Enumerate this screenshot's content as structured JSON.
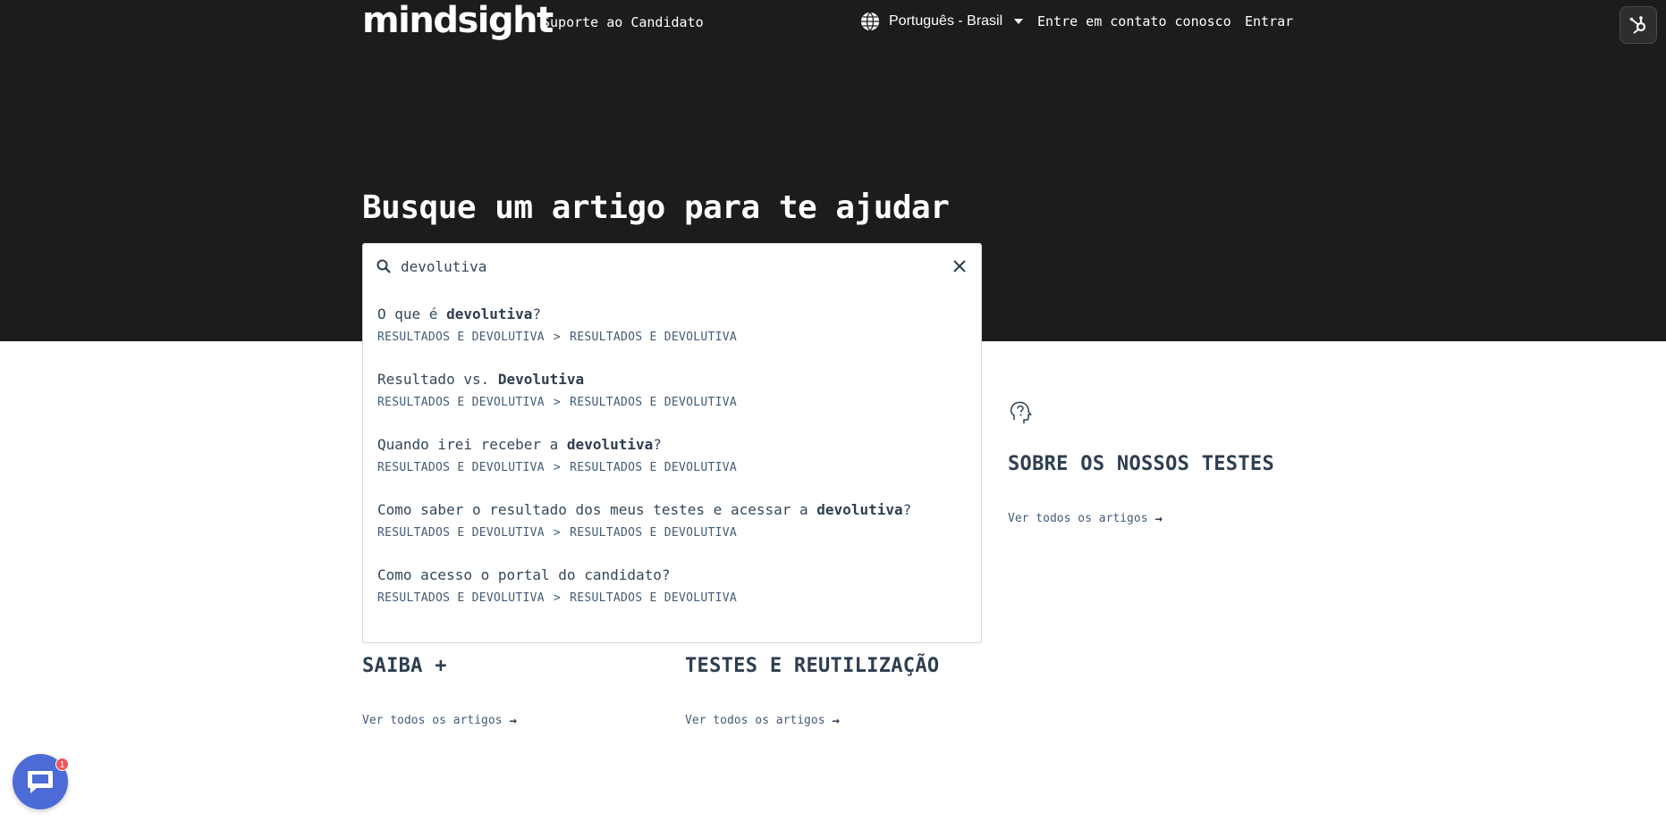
{
  "header": {
    "logo": "mindsight",
    "portal_name": "Suporte ao Candidato",
    "language": "Português - Brasil",
    "contact_label": "Entre em contato conosco",
    "login_label": "Entrar"
  },
  "hero": {
    "title": "Busque um artigo para te ajudar"
  },
  "search": {
    "value": "devolutiva",
    "results": [
      {
        "title_before": "O que é ",
        "title_match": "devolutiva",
        "title_after": "?",
        "crumb_category": "RESULTADOS E DEVOLUTIVA",
        "crumb_separator": ">",
        "crumb_section": "RESULTADOS E DEVOLUTIVA"
      },
      {
        "title_before": "Resultado vs. ",
        "title_match": "Devolutiva",
        "title_after": "",
        "crumb_category": "RESULTADOS E DEVOLUTIVA",
        "crumb_separator": ">",
        "crumb_section": "RESULTADOS E DEVOLUTIVA"
      },
      {
        "title_before": "Quando irei receber a ",
        "title_match": "devolutiva",
        "title_after": "?",
        "crumb_category": "RESULTADOS E DEVOLUTIVA",
        "crumb_separator": ">",
        "crumb_section": "RESULTADOS E DEVOLUTIVA"
      },
      {
        "title_before": "Como saber o resultado dos meus testes e acessar a ",
        "title_match": "devolutiva",
        "title_after": "?",
        "crumb_category": "RESULTADOS E DEVOLUTIVA",
        "crumb_separator": ">",
        "crumb_section": "RESULTADOS E DEVOLUTIVA"
      },
      {
        "title_before": "Como acesso o portal do candidato?",
        "title_match": "",
        "title_after": "",
        "crumb_category": "RESULTADOS E DEVOLUTIVA",
        "crumb_separator": ">",
        "crumb_section": "RESULTADOS E DEVOLUTIVA"
      }
    ]
  },
  "categories": {
    "sobre": {
      "title": "SOBRE OS NOSSOS TESTES",
      "see_all": "Ver todos os artigos",
      "icon": "question-head-icon"
    },
    "saiba": {
      "title": "SAIBA +",
      "see_all": "Ver todos os artigos"
    },
    "testes": {
      "title": "TESTES E REUTILIZAÇÃO",
      "see_all": "Ver todos os artigos"
    }
  },
  "chat": {
    "badge_count": "1"
  },
  "colors": {
    "hero_bg": "#1c1c1c",
    "heading": "#2d3e50",
    "chat": "#4d6bd6",
    "badge": "#f2545b"
  }
}
